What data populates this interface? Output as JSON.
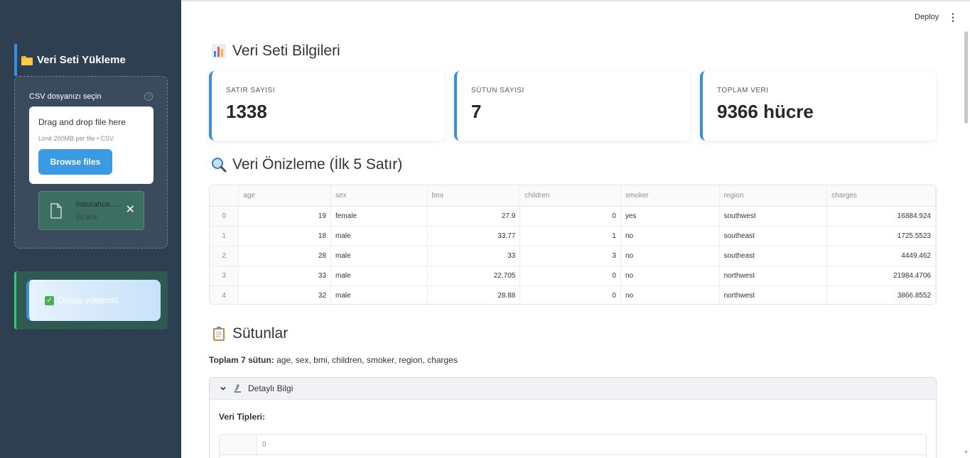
{
  "sidebar": {
    "title": "Veri Seti Yükleme",
    "uploader": {
      "label": "CSV dosyanızı seçin",
      "dropzone_title": "Drag and drop file here",
      "limit_text": "Limit 200MB per file • CSV",
      "browse_label": "Browse files",
      "file": {
        "name": "insurance....",
        "size": "54.3KB"
      }
    },
    "success_message": "Dosya yüklendi!"
  },
  "header": {
    "deploy_label": "Deploy",
    "menu_icon": "kebab-menu-icon"
  },
  "main": {
    "section1_title": "Veri Seti Bilgileri",
    "metrics": [
      {
        "label": "SATIR SAYISI",
        "value": "1338"
      },
      {
        "label": "SÜTUN SAYISI",
        "value": "7"
      },
      {
        "label": "TOPLAM VERI",
        "value": "9366 hücre"
      }
    ],
    "section2_title": "Veri Önizleme (İlk 5 Satır)",
    "preview": {
      "columns": [
        "age",
        "sex",
        "bmi",
        "children",
        "smoker",
        "region",
        "charges"
      ],
      "rows": [
        {
          "index": "0",
          "age": "19",
          "sex": "female",
          "bmi": "27.9",
          "children": "0",
          "smoker": "yes",
          "region": "southwest",
          "charges": "16884.924"
        },
        {
          "index": "1",
          "age": "18",
          "sex": "male",
          "bmi": "33.77",
          "children": "1",
          "smoker": "no",
          "region": "southeast",
          "charges": "1725.5523"
        },
        {
          "index": "2",
          "age": "28",
          "sex": "male",
          "bmi": "33",
          "children": "3",
          "smoker": "no",
          "region": "southeast",
          "charges": "4449.462"
        },
        {
          "index": "3",
          "age": "33",
          "sex": "male",
          "bmi": "22.705",
          "children": "0",
          "smoker": "no",
          "region": "northwest",
          "charges": "21984.4706"
        },
        {
          "index": "4",
          "age": "32",
          "sex": "male",
          "bmi": "28.88",
          "children": "0",
          "smoker": "no",
          "region": "northwest",
          "charges": "3866.8552"
        }
      ]
    },
    "section3_title": "Sütunlar",
    "columns_summary_label": "Toplam 7 sütun:",
    "columns_summary_text": " age, sex, bmi, children, smoker, region, charges",
    "expander": {
      "title": "Detaylı Bilgi",
      "dtypes_label": "Veri Tipleri:",
      "dtypes_col_header": "0"
    }
  },
  "colors": {
    "sidebar_bg": "#2e3f52",
    "accent": "#3b8fd9",
    "success": "#2ecc71",
    "button": "#3b9ae1"
  }
}
